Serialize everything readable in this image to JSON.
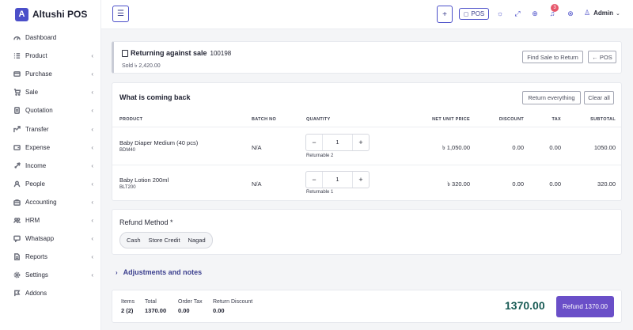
{
  "app": {
    "logo_letter": "A",
    "name": "Altushi POS"
  },
  "sidebar": {
    "items": [
      {
        "label": "Dashboard",
        "icon": "dashboard-icon",
        "chevron": ""
      },
      {
        "label": "Product",
        "icon": "list-icon",
        "chevron": "‹"
      },
      {
        "label": "Purchase",
        "icon": "card-icon",
        "chevron": "‹"
      },
      {
        "label": "Sale",
        "icon": "cart-icon",
        "chevron": "‹"
      },
      {
        "label": "Quotation",
        "icon": "quote-icon",
        "chevron": "‹"
      },
      {
        "label": "Transfer",
        "icon": "transfer-icon",
        "chevron": "‹"
      },
      {
        "label": "Expense",
        "icon": "wallet-icon",
        "chevron": "‹"
      },
      {
        "label": "Income",
        "icon": "rocket-icon",
        "chevron": "‹"
      },
      {
        "label": "People",
        "icon": "person-icon",
        "chevron": "‹"
      },
      {
        "label": "Accounting",
        "icon": "briefcase-icon",
        "chevron": "‹"
      },
      {
        "label": "HRM",
        "icon": "people-icon",
        "chevron": "‹"
      },
      {
        "label": "Whatsapp",
        "icon": "chat-icon",
        "chevron": "‹"
      },
      {
        "label": "Reports",
        "icon": "report-icon",
        "chevron": "‹"
      },
      {
        "label": "Settings",
        "icon": "gear-icon",
        "chevron": "‹"
      },
      {
        "label": "Addons",
        "icon": "flag-icon",
        "chevron": ""
      }
    ]
  },
  "topbar": {
    "menu_glyph": "☰",
    "plus_glyph": "+",
    "pos_label": "POS",
    "notification_count": "3",
    "user_name": "Admin"
  },
  "return_info": {
    "title": "Returning against sale",
    "sale_number": "100198",
    "sold_text": "Sold ৳ 2,420.00",
    "find_sale_label": "Find Sale to Return",
    "back_pos_label": "← POS"
  },
  "items_section": {
    "title": "What is coming back",
    "return_everything_label": "Return everything",
    "clear_all_label": "Clear all",
    "columns": {
      "product": "PRODUCT",
      "batch": "BATCH NO",
      "quantity": "QUANTITY",
      "net_unit_price": "NET UNIT PRICE",
      "discount": "DISCOUNT",
      "tax": "TAX",
      "subtotal": "SUBTOTAL"
    },
    "rows": [
      {
        "name": "Baby Diaper Medium (40 pcs)",
        "code": "BDM40",
        "batch": "N/A",
        "quantity": "1",
        "returnable": "Returnable 2",
        "price": "৳ 1,050.00",
        "discount": "0.00",
        "tax": "0.00",
        "subtotal": "1050.00"
      },
      {
        "name": "Baby Lotion 200ml",
        "code": "BLT200",
        "batch": "N/A",
        "quantity": "1",
        "returnable": "Returnable 1",
        "price": "৳ 320.00",
        "discount": "0.00",
        "tax": "0.00",
        "subtotal": "320.00"
      }
    ]
  },
  "refund": {
    "title": "Refund Method *",
    "options": [
      "Cash",
      "Store Credit",
      "Nagad"
    ]
  },
  "adjustments": {
    "label": "Adjustments and notes"
  },
  "footer": {
    "items_label": "Items",
    "items_value": "2 (2)",
    "total_label": "Total",
    "total_value": "1370.00",
    "order_tax_label": "Order Tax",
    "order_tax_value": "0.00",
    "return_discount_label": "Return Discount",
    "return_discount_value": "0.00",
    "grand_total": "1370.00",
    "refund_button_label": "Refund 1370.00"
  },
  "colors": {
    "accent": "#4b4fc9",
    "refund_button": "#6a4fc8",
    "grand_total": "#1a5c56",
    "badge": "#e6576b"
  }
}
